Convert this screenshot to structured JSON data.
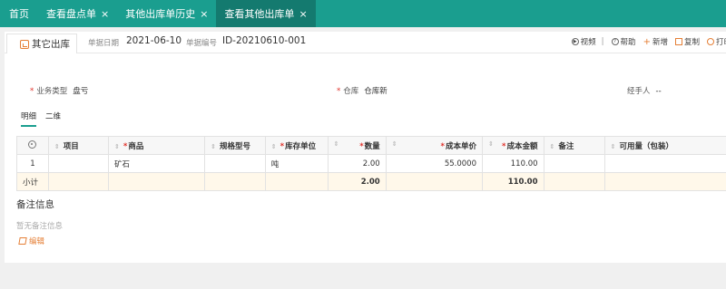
{
  "tabs": [
    {
      "label": "首页",
      "closable": false,
      "active": false
    },
    {
      "label": "查看盘点单",
      "closable": true,
      "active": false
    },
    {
      "label": "其他出库单历史",
      "closable": true,
      "active": false
    },
    {
      "label": "查看其他出库单",
      "closable": true,
      "active": true
    }
  ],
  "close_glyph": "×",
  "header": {
    "type_label": "其它出库",
    "date_label": "单据日期",
    "date_value": "2021-06-10",
    "number_label": "单据编号",
    "number_value": "ID-20210610-001"
  },
  "toolbar": {
    "video": "视频",
    "help": "帮助",
    "add": "新增",
    "copy": "复制",
    "print": "打印"
  },
  "form": {
    "biz_type_label": "业务类型",
    "biz_type_value": "盘亏",
    "warehouse_label": "仓库",
    "warehouse_value": "仓库新",
    "handler_label": "经手人",
    "handler_value": "--"
  },
  "subtabs": [
    "明细",
    "二维"
  ],
  "table": {
    "headers": {
      "item": "项目",
      "product": "商品",
      "spec": "规格型号",
      "unit": "库存单位",
      "qty": "数量",
      "unit_cost": "成本单价",
      "cost_amount": "成本金额",
      "remark": "备注",
      "available": "可用量（包装）"
    },
    "rows": [
      {
        "idx": "1",
        "item": "",
        "product": "矿石",
        "spec": "",
        "unit": "吨",
        "qty": "2.00",
        "unit_cost": "55.0000",
        "cost_amount": "110.00",
        "remark": "",
        "available": ""
      }
    ],
    "subtotal": {
      "label": "小计",
      "qty": "2.00",
      "cost_amount": "110.00"
    }
  },
  "remarks": {
    "title": "备注信息",
    "empty_text": "暂无备注信息",
    "edit_label": "编辑"
  },
  "colors": {
    "accent": "#1a9e8f",
    "orange": "#e57f36",
    "required": "#e0312a"
  }
}
